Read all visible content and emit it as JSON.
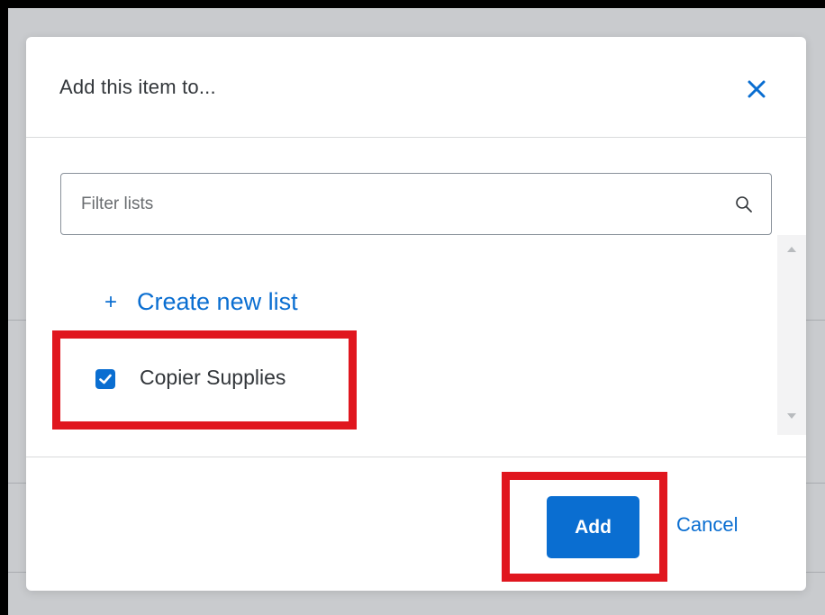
{
  "dialog": {
    "title": "Add this item to...",
    "close_icon": "close-icon"
  },
  "search": {
    "placeholder": "Filter lists",
    "value": "",
    "icon": "search-icon"
  },
  "create_new": {
    "plus": "+",
    "label": "Create new list"
  },
  "lists": [
    {
      "label": "Copier Supplies",
      "checked": true
    }
  ],
  "footer": {
    "add_label": "Add",
    "cancel_label": "Cancel"
  },
  "colors": {
    "accent": "#0a6ed1",
    "highlight": "#e0161e",
    "text": "#32363a",
    "backdrop": "#c9cbce"
  }
}
